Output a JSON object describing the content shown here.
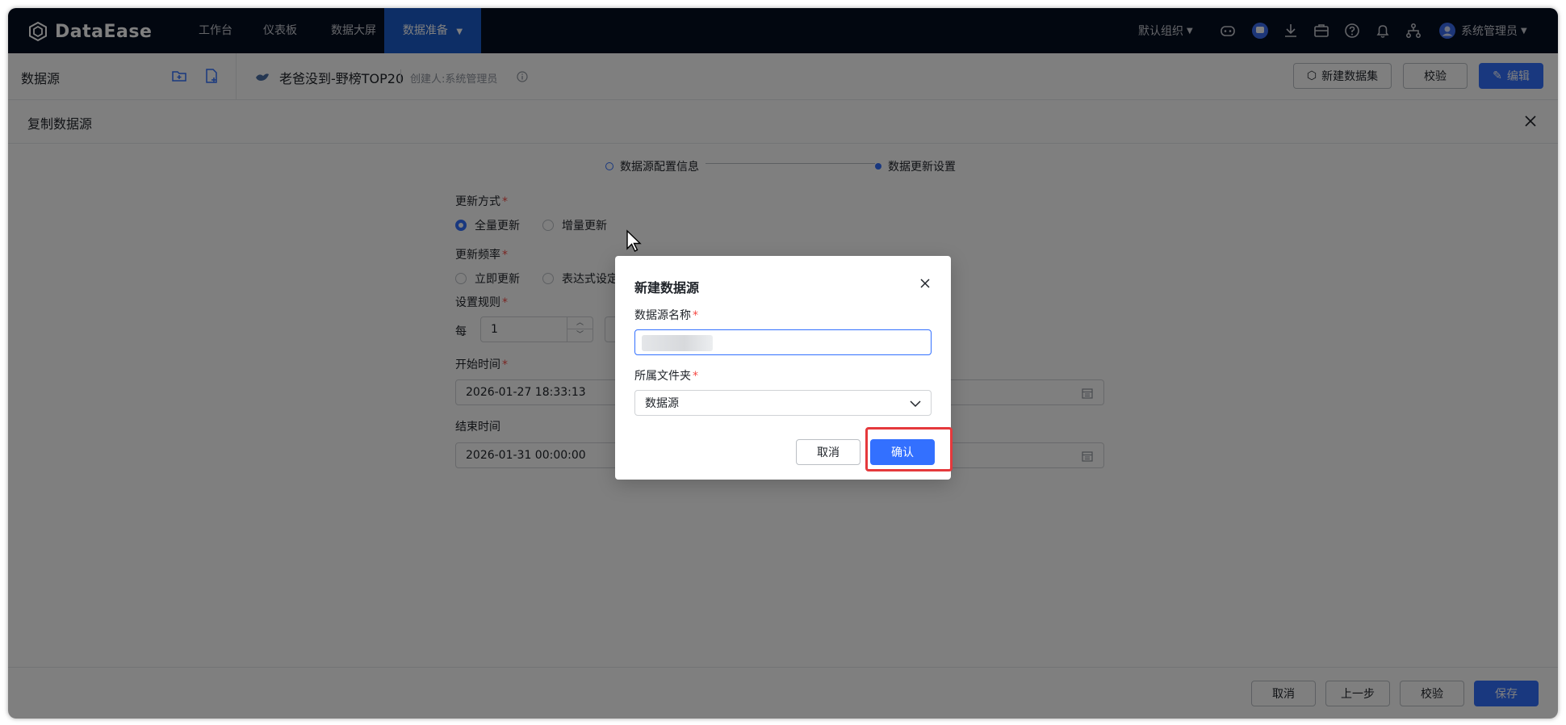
{
  "nav": {
    "brand": "DataEase",
    "tabs": [
      {
        "label": "工作台"
      },
      {
        "label": "仪表板"
      },
      {
        "label": "数据大屏"
      },
      {
        "label": "数据准备"
      }
    ],
    "org": "默认组织",
    "user": "系统管理员",
    "icons": [
      "ai-icon",
      "chat-icon",
      "download-icon",
      "briefcase-icon",
      "help-icon",
      "bell-icon",
      "org-chart-icon"
    ],
    "active_color": "#1b5ccc"
  },
  "sub_header": {
    "section": "数据源",
    "datasource_name": "老爸没到-野榜TOP20",
    "creator": "创建人:系统管理员",
    "new_dataset_label": "新建数据集",
    "validate_label": "校验",
    "edit_label": "编辑"
  },
  "drawer": {
    "title": "复制数据源",
    "steps": [
      "数据源配置信息",
      "数据更新设置"
    ],
    "update_mode_label": "更新方式",
    "update_modes": [
      "全量更新",
      "增量更新"
    ],
    "frequency_label": "更新频率",
    "frequencies": [
      "立即更新",
      "表达式设定"
    ],
    "rule_label": "设置规则",
    "rule_prefix": "每",
    "rule_value": "1",
    "start_label": "开始时间",
    "start_value": "2026-01-27 18:33:13",
    "end_label": "结束时间",
    "end_value": "2026-01-31 00:00:00"
  },
  "footer": {
    "cancel": "取消",
    "prev": "上一步",
    "validate": "校验",
    "save": "保存"
  },
  "dialog": {
    "title": "新建数据源",
    "name_label": "数据源名称",
    "folder_label": "所属文件夹",
    "folder_value": "数据源",
    "cancel": "取消",
    "confirm": "确认"
  },
  "colors": {
    "primary": "#3370ff",
    "highlight": "#e5393c"
  }
}
